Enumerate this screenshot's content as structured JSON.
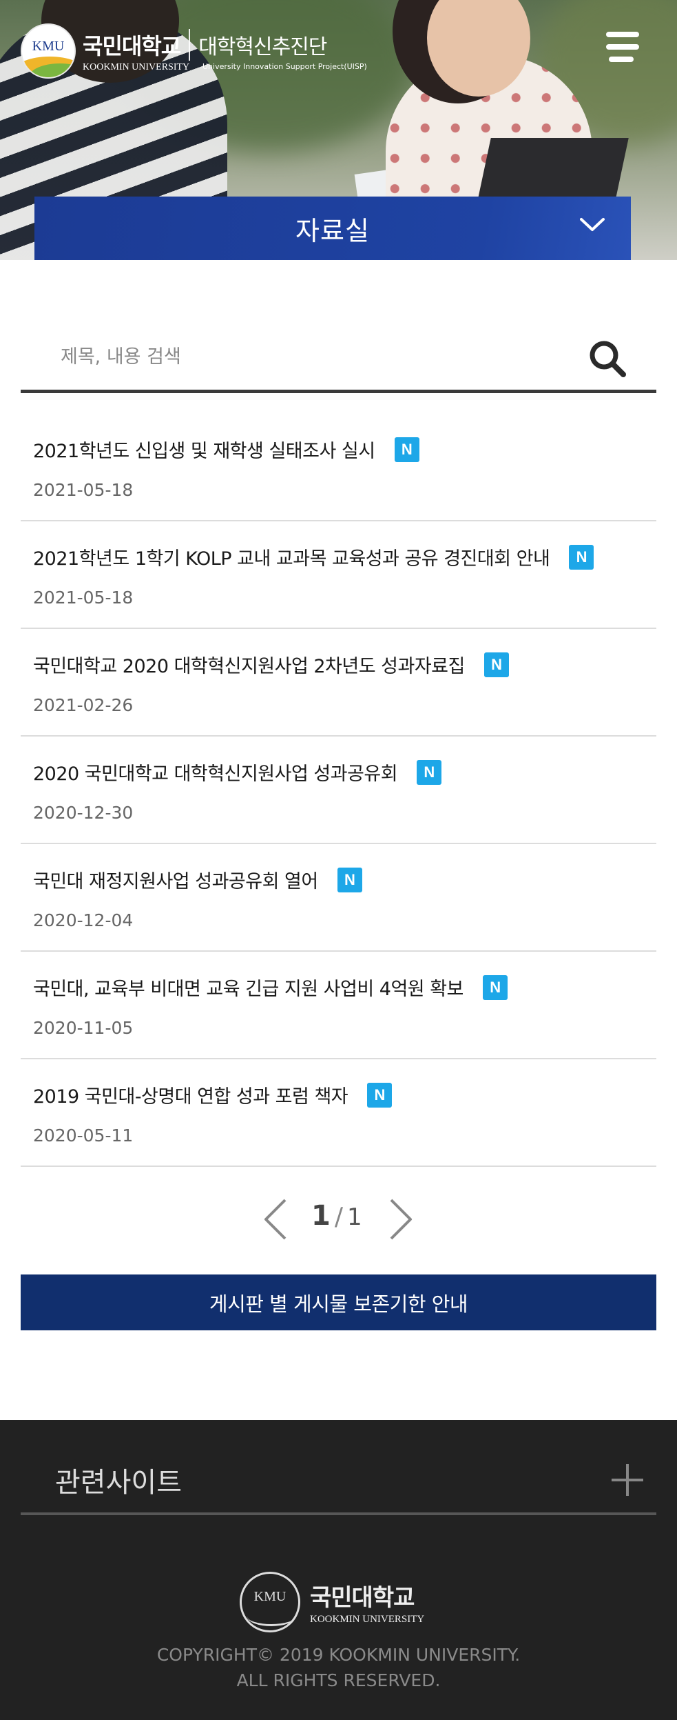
{
  "header": {
    "logo_emblem_text": "KMU",
    "logo_ko": "국민대학교",
    "logo_sub": "대학혁신추진단",
    "logo_en": "KOOKMIN UNIVERSITY",
    "logo_en_sub": "University Innovation Support Project(UISP)",
    "menu_icon": "hamburger-menu-icon",
    "section_title": "자료실",
    "section_icon": "chevron-down-icon"
  },
  "search": {
    "placeholder": "제목, 내용 검색",
    "value": "",
    "icon": "search-icon"
  },
  "posts": [
    {
      "title": "2021학년도 신입생 및 재학생 실태조사 실시",
      "badge": "N",
      "date": "2021-05-18"
    },
    {
      "title": "2021학년도 1학기 KOLP 교내 교과목 교육성과 공유 경진대회 안내",
      "badge": "N",
      "date": "2021-05-18"
    },
    {
      "title": "국민대학교 2020 대학혁신지원사업 2차년도 성과자료집",
      "badge": "N",
      "date": "2021-02-26"
    },
    {
      "title": "2020 국민대학교 대학혁신지원사업 성과공유회",
      "badge": "N",
      "date": "2020-12-30"
    },
    {
      "title": "국민대 재정지원사업 성과공유회 열어",
      "badge": "N",
      "date": "2020-12-04"
    },
    {
      "title": "국민대, 교육부 비대면 교육 긴급 지원 사업비 4억원 확보",
      "badge": "N",
      "date": "2020-11-05"
    },
    {
      "title": "2019 국민대-상명대 연합 성과 포럼 책자",
      "badge": "N",
      "date": "2020-05-11"
    }
  ],
  "pagination": {
    "current": "1",
    "separator": "/",
    "total": "1"
  },
  "notice_button": "게시판 별 게시물 보존기한 안내",
  "footer": {
    "related_label": "관련사이트",
    "logo_emblem_text": "KMU",
    "logo_ko": "국민대학교",
    "logo_en": "KOOKMIN UNIVERSITY",
    "copyright_line1": "COPYRIGHT© 2019 KOOKMIN UNIVERSITY.",
    "copyright_line2": "ALL RIGHTS RESERVED."
  },
  "colors": {
    "section_blue": "#1f43a3",
    "notice_navy": "#112f6e",
    "badge_blue": "#1da7e8",
    "footer_bg": "#222222"
  }
}
